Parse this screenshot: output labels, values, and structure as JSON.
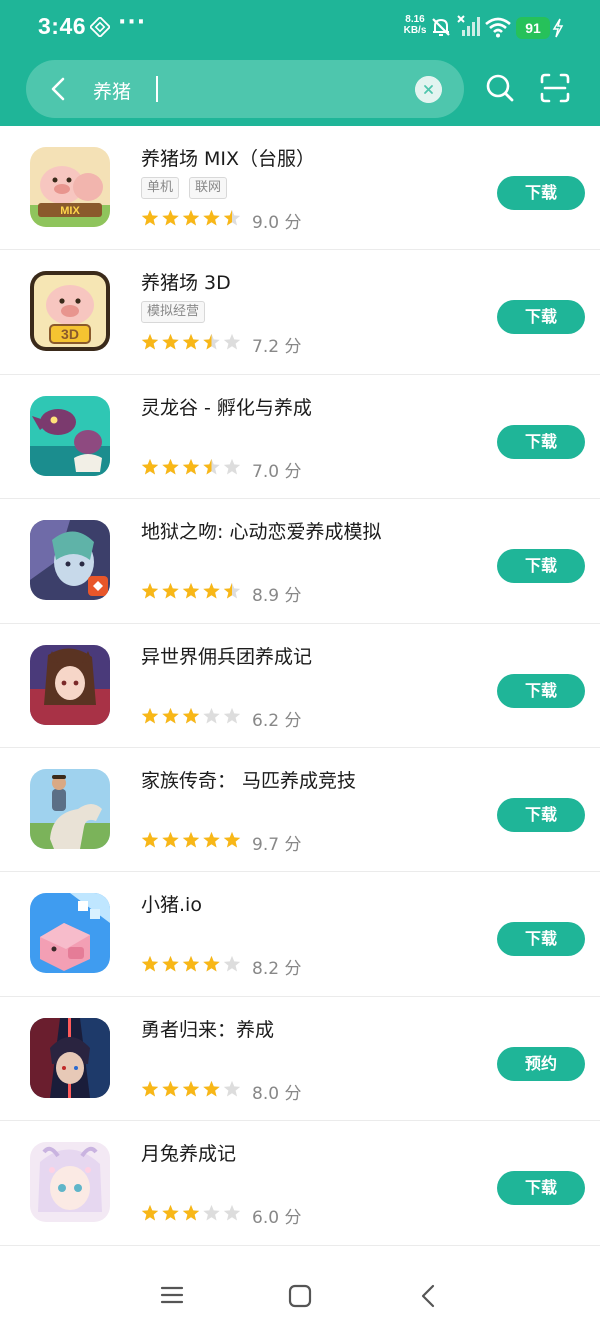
{
  "status_bar": {
    "time": "3:46",
    "more": "···",
    "net_speed_value": "8.16",
    "net_speed_unit": "KB/s",
    "battery": "91"
  },
  "search": {
    "query": "养猪"
  },
  "colors": {
    "accent": "#1fb598",
    "star": "#f8b717",
    "star_empty": "#dddddd"
  },
  "results": [
    {
      "title": "养猪场 MIX（台服）",
      "tags": [
        "单机",
        "联网"
      ],
      "rating": 4.5,
      "score": "9.0 分",
      "action": "下载",
      "icon": "pig-farm-mix-icon"
    },
    {
      "title": "养猪场 3D",
      "tags": [
        "模拟经营"
      ],
      "rating": 3.5,
      "score": "7.2 分",
      "action": "下载",
      "icon": "pig-farm-3d-icon"
    },
    {
      "title": "灵龙谷 - 孵化与养成",
      "tags": [],
      "rating": 3.5,
      "score": "7.0 分",
      "action": "下载",
      "icon": "dragon-valley-icon"
    },
    {
      "title": "地狱之吻: 心动恋爱养成模拟",
      "tags": [],
      "rating": 4.5,
      "score": "8.9 分",
      "action": "下载",
      "icon": "hell-kiss-icon"
    },
    {
      "title": "异世界佣兵团养成记",
      "tags": [],
      "rating": 3,
      "score": "6.2 分",
      "action": "下载",
      "icon": "mercenary-girl-icon"
    },
    {
      "title": "家族传奇： 马匹养成竞技",
      "tags": [],
      "rating": 5,
      "score": "9.7 分",
      "action": "下载",
      "icon": "horse-rider-icon"
    },
    {
      "title": "小猪.io",
      "tags": [],
      "rating": 4,
      "score": "8.2 分",
      "action": "下载",
      "icon": "pig-io-icon"
    },
    {
      "title": "勇者归来：养成",
      "tags": [],
      "rating": 4,
      "score": "8.0 分",
      "action": "预约",
      "icon": "hero-return-icon"
    },
    {
      "title": "月兔养成记",
      "tags": [],
      "rating": 3,
      "score": "6.0 分",
      "action": "下载",
      "icon": "moon-rabbit-icon"
    }
  ]
}
